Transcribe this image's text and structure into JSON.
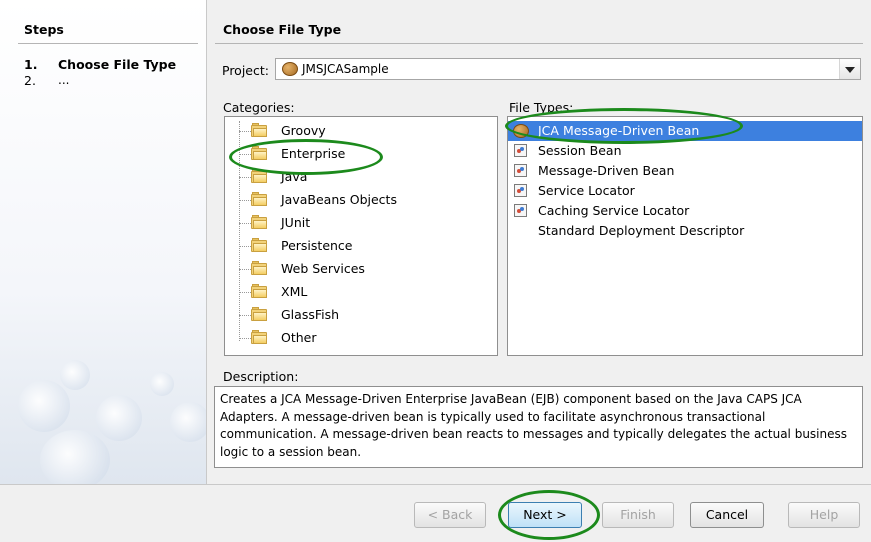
{
  "steps": {
    "title": "Steps",
    "items": [
      {
        "number": "1.",
        "label": "Choose File Type"
      },
      {
        "number": "2.",
        "label": "..."
      }
    ]
  },
  "main": {
    "title": "Choose File Type",
    "project_label": "Project:",
    "project_value": "JMSJCASample",
    "categories_label": "Categories:",
    "file_types_label": "File Types:",
    "description_label": "Description:"
  },
  "categories": [
    {
      "label": "Groovy"
    },
    {
      "label": "Enterprise"
    },
    {
      "label": "Java"
    },
    {
      "label": "JavaBeans Objects"
    },
    {
      "label": "JUnit"
    },
    {
      "label": "Persistence"
    },
    {
      "label": "Web Services"
    },
    {
      "label": "XML"
    },
    {
      "label": "GlassFish"
    },
    {
      "label": "Other"
    }
  ],
  "file_types": [
    {
      "label": "JCA Message-Driven Bean",
      "icon": "coffee-bean-icon"
    },
    {
      "label": "Session Bean",
      "icon": "bean-icon"
    },
    {
      "label": "Message-Driven Bean",
      "icon": "bean-icon"
    },
    {
      "label": "Service Locator",
      "icon": "bean-icon"
    },
    {
      "label": "Caching Service Locator",
      "icon": "bean-icon"
    },
    {
      "label": "Standard Deployment Descriptor",
      "icon": ""
    }
  ],
  "description": "Creates a JCA Message-Driven Enterprise JavaBean (EJB) component based on the Java CAPS JCA Adapters. A message-driven bean is typically used to facilitate asynchronous transactional communication. A message-driven bean reacts to messages and typically delegates the actual business logic to a session bean.",
  "buttons": {
    "back": "< Back",
    "next": "Next >",
    "finish": "Finish",
    "cancel": "Cancel",
    "help": "Help"
  },
  "colors": {
    "selection": "#3d80df",
    "highlight": "#1c8a1c"
  }
}
